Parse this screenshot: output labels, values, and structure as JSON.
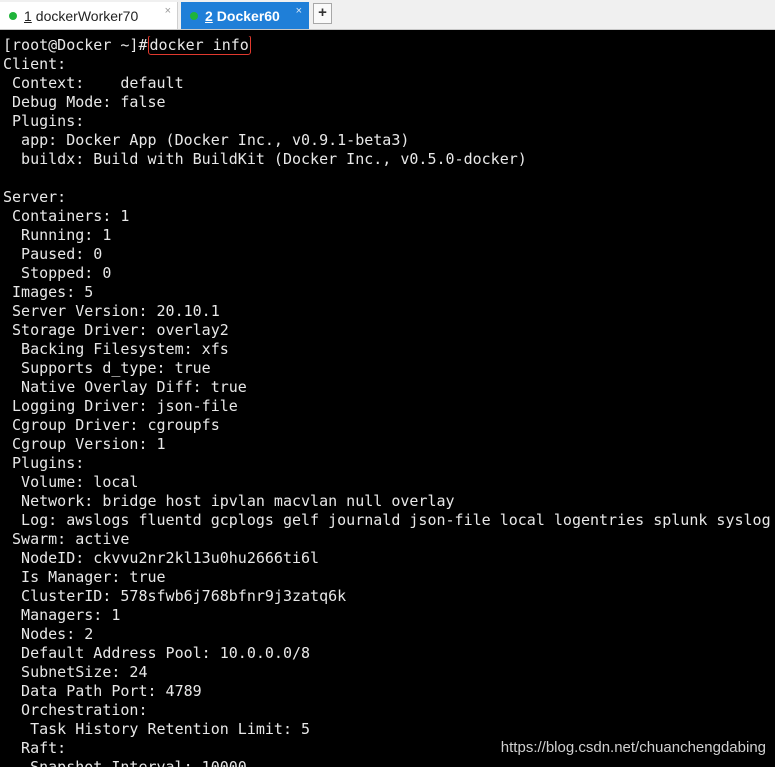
{
  "tabs": [
    {
      "num": "1",
      "title": "dockerWorker70",
      "close": "×",
      "status_color": "#1fb43a",
      "active": false
    },
    {
      "num": "2",
      "title": "Docker60",
      "close": "×",
      "status_color": "#1fb43a",
      "active": true
    }
  ],
  "add_tab_label": "+",
  "terminal": {
    "prompt": "[root@Docker ~]#",
    "command": "docker info",
    "lines": [
      "Client:",
      " Context:    default",
      " Debug Mode: false",
      " Plugins:",
      "  app: Docker App (Docker Inc., v0.9.1-beta3)",
      "  buildx: Build with BuildKit (Docker Inc., v0.5.0-docker)",
      "",
      "Server:",
      " Containers: 1",
      "  Running: 1",
      "  Paused: 0",
      "  Stopped: 0",
      " Images: 5",
      " Server Version: 20.10.1",
      " Storage Driver: overlay2",
      "  Backing Filesystem: xfs",
      "  Supports d_type: true",
      "  Native Overlay Diff: true",
      " Logging Driver: json-file",
      " Cgroup Driver: cgroupfs",
      " Cgroup Version: 1",
      " Plugins:",
      "  Volume: local",
      "  Network: bridge host ipvlan macvlan null overlay",
      "  Log: awslogs fluentd gcplogs gelf journald json-file local logentries splunk syslog",
      " Swarm: active",
      "  NodeID: ckvvu2nr2kl13u0hu2666ti6l",
      "  Is Manager: true",
      "  ClusterID: 578sfwb6j768bfnr9j3zatq6k",
      "  Managers: 1",
      "  Nodes: 2",
      "  Default Address Pool: 10.0.0.0/8",
      "  SubnetSize: 24",
      "  Data Path Port: 4789",
      "  Orchestration:",
      "   Task History Retention Limit: 5",
      "  Raft:",
      "   Snapshot Interval: 10000"
    ]
  },
  "watermark": "https://blog.csdn.net/chuanchengdabing",
  "colors": {
    "terminal_bg": "#000000",
    "terminal_text": "#e8e8e8",
    "active_tab": "#1f7fd8",
    "command_highlight": "#e0392e"
  }
}
